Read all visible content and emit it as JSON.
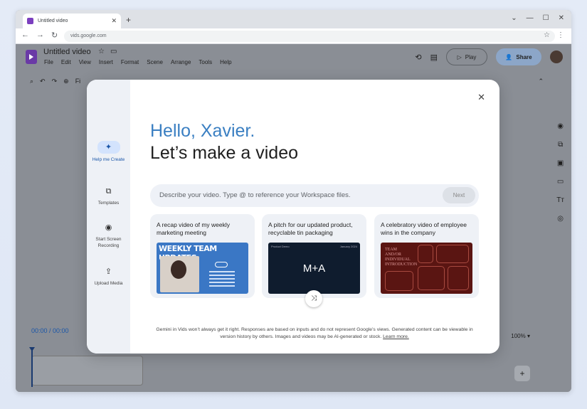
{
  "browser": {
    "tab_title": "Untitled video",
    "new_tab": "+",
    "url": "vids.google.com",
    "window_controls": [
      "⌄",
      "—",
      "☐",
      "✕"
    ]
  },
  "app": {
    "doc_title": "Untitled video",
    "menu": [
      "File",
      "Edit",
      "View",
      "Insert",
      "Format",
      "Scene",
      "Arrange",
      "Tools",
      "Help"
    ],
    "play_label": "Play",
    "share_label": "Share",
    "toolbar_fit": "Fi",
    "timecode": "00:00 / 00:00",
    "zoom": "100%",
    "colors": {
      "accent": "#3a7fc2",
      "share_bg": "#8ca6c8",
      "brand": "#6a3aa6"
    }
  },
  "dialog": {
    "sidebar": [
      {
        "label": "Help me Create",
        "icon": "sparkle-icon",
        "active": true
      },
      {
        "label": "Templates",
        "icon": "templates-icon",
        "active": false
      },
      {
        "label": "Start Screen Recording",
        "icon": "record-icon",
        "active": false
      },
      {
        "label": "Upload Media",
        "icon": "upload-icon",
        "active": false
      }
    ],
    "greeting": "Hello, Xavier.",
    "headline": "Let’s make a video",
    "prompt_placeholder": "Describe your video. Type @ to reference your Workspace files.",
    "next_label": "Next",
    "cards": [
      {
        "title": "A recap video of my weekly marketing meeting",
        "thumb_heading": "WEEKLY TEAM UPDATES"
      },
      {
        "title": "A pitch for our updated product, recyclable tin packaging",
        "thumb_left": "Product Demo",
        "thumb_right": "January 2024",
        "thumb_center": "M+A"
      },
      {
        "title": "A celebratory video of employee wins in the company",
        "thumb_heading": "TEAM AND/OR INDIVIDUAL INTRODUCTION"
      }
    ],
    "disclaimer": "Gemini in Vids won’t always get it right. Responses are based on inputs and do not represent Google’s views. Generated content can be viewable in version history by others. Images and videos may be AI-generated or stock.",
    "learn_more": "Learn more."
  }
}
